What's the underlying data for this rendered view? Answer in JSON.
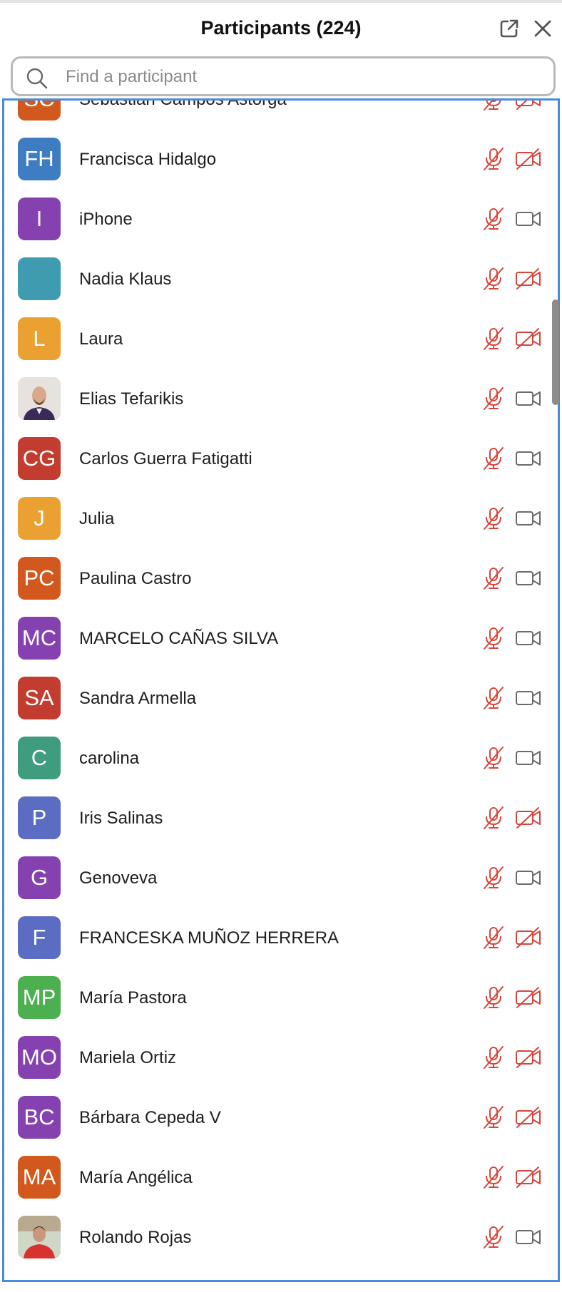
{
  "header": {
    "title": "Participants (224)",
    "popout_icon": "popout-icon",
    "close_icon": "close-icon"
  },
  "search": {
    "placeholder": "Find a participant",
    "value": "",
    "icon": "search-icon"
  },
  "colors": {
    "muted": "#d9453b",
    "video_on": "#6b6b6b",
    "focus_border": "#4a8ae0"
  },
  "participants": [
    {
      "initials": "SC",
      "name": "Sebastián Campos Astorga",
      "color": "#d2581d",
      "audio": "muted",
      "video": "off"
    },
    {
      "initials": "FH",
      "name": "Francisca Hidalgo",
      "color": "#3e7dc2",
      "audio": "muted",
      "video": "off"
    },
    {
      "initials": "I",
      "name": "iPhone",
      "color": "#8541b0",
      "audio": "muted",
      "video": "on"
    },
    {
      "initials": "",
      "name": "Nadia Klaus",
      "color": "#3f9cb0",
      "audio": "muted",
      "video": "off"
    },
    {
      "initials": "L",
      "name": "Laura",
      "color": "#eba032",
      "audio": "muted",
      "video": "off"
    },
    {
      "initials": "",
      "name": "Elias Tefarikis",
      "color": "#d9d4cf",
      "photo": true,
      "audio": "muted",
      "video": "on"
    },
    {
      "initials": "CG",
      "name": "Carlos Guerra Fatigatti",
      "color": "#c23c2f",
      "audio": "muted",
      "video": "on"
    },
    {
      "initials": "J",
      "name": "Julia",
      "color": "#eba032",
      "audio": "muted",
      "video": "on"
    },
    {
      "initials": "PC",
      "name": "Paulina Castro",
      "color": "#d2581d",
      "audio": "muted",
      "video": "on"
    },
    {
      "initials": "MC",
      "name": "MARCELO CAÑAS SILVA",
      "color": "#8541b0",
      "audio": "muted",
      "video": "on"
    },
    {
      "initials": "SA",
      "name": "Sandra Armella",
      "color": "#c23c2f",
      "audio": "muted",
      "video": "on"
    },
    {
      "initials": "C",
      "name": "carolina",
      "color": "#3f9c7e",
      "audio": "muted",
      "video": "on"
    },
    {
      "initials": "P",
      "name": "Iris Salinas",
      "color": "#5b6dc2",
      "audio": "muted",
      "video": "off"
    },
    {
      "initials": "G",
      "name": "Genoveva",
      "color": "#8541b0",
      "audio": "muted",
      "video": "on"
    },
    {
      "initials": "F",
      "name": "FRANCESKA MUÑOZ HERRERA",
      "color": "#5b6dc2",
      "audio": "muted",
      "video": "off"
    },
    {
      "initials": "MP",
      "name": "María Pastora",
      "color": "#4caf50",
      "audio": "muted",
      "video": "off"
    },
    {
      "initials": "MO",
      "name": "Mariela Ortiz",
      "color": "#8541b0",
      "audio": "muted",
      "video": "off"
    },
    {
      "initials": "BC",
      "name": "Bárbara Cepeda V",
      "color": "#8541b0",
      "audio": "muted",
      "video": "off"
    },
    {
      "initials": "MA",
      "name": "María Angélica",
      "color": "#d2581d",
      "audio": "muted",
      "video": "off"
    },
    {
      "initials": "",
      "name": "Rolando Rojas",
      "color": "#d9d4cf",
      "photo": true,
      "audio": "muted",
      "video": "on"
    }
  ]
}
